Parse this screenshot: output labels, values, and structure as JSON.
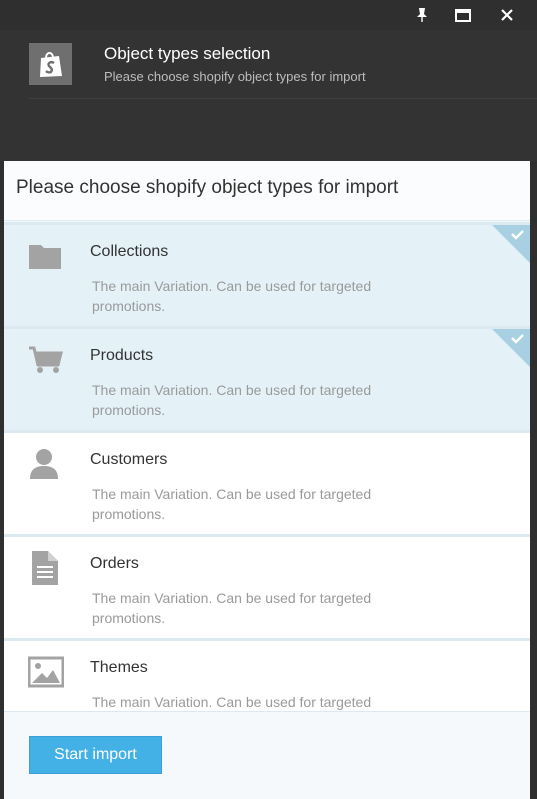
{
  "window_controls": {
    "pin_icon": "pin-icon",
    "maximize_icon": "maximize-icon",
    "close_icon": "close-icon"
  },
  "header": {
    "title": "Object types selection",
    "subtitle": "Please choose shopify object types for import",
    "logo_icon": "shopify-bag-icon"
  },
  "panel": {
    "title": "Please choose shopify object types for import"
  },
  "items": [
    {
      "label": "Collections",
      "description": "The main Variation. Can be used for targeted promotions.",
      "icon": "folder-icon",
      "selected": true
    },
    {
      "label": "Products",
      "description": "The main Variation. Can be used for targeted promotions.",
      "icon": "cart-icon",
      "selected": true
    },
    {
      "label": "Customers",
      "description": "The main Variation. Can be used for targeted promotions.",
      "icon": "user-icon",
      "selected": false
    },
    {
      "label": "Orders",
      "description": "The main Variation. Can be used for targeted promotions.",
      "icon": "document-icon",
      "selected": false
    },
    {
      "label": "Themes",
      "description": "The main Variation. Can be used for targeted",
      "icon": "image-icon",
      "selected": false
    }
  ],
  "footer": {
    "start_button": "Start import"
  },
  "colors": {
    "accent": "#43b0e6",
    "selected_bg": "#e4f2f8",
    "check_corner": "#a8cfe2",
    "header_bg": "#333333"
  }
}
